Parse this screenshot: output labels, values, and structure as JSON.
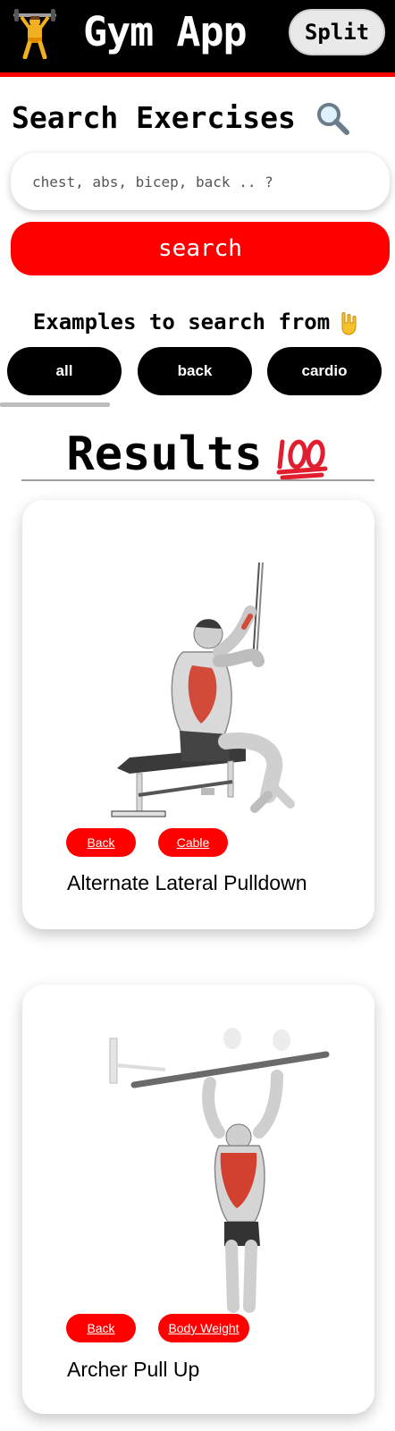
{
  "header": {
    "title": "Gym App",
    "split_label": "Split",
    "icon": "weightlifter-icon"
  },
  "search": {
    "heading": "Search Exercises",
    "heading_icon": "magnifier-icon",
    "placeholder": "chest, abs, bicep, back .. ?",
    "button_label": "search"
  },
  "examples": {
    "heading": "Examples to search from",
    "heading_icon": "pointing-down-icon",
    "chips": [
      "all",
      "back",
      "cardio"
    ]
  },
  "results": {
    "heading": "Results",
    "heading_icon": "hundred-points-icon",
    "items": [
      {
        "title": "Alternate Lateral Pulldown",
        "tags": [
          "Back",
          "Cable"
        ],
        "image": "lat-pulldown-illustration"
      },
      {
        "title": "Archer Pull Up",
        "tags": [
          "Back",
          "Body Weight"
        ],
        "image": "pull-up-illustration"
      }
    ]
  },
  "colors": {
    "accent": "#ff0000",
    "header_bg": "#000000",
    "chip_bg": "#000000"
  }
}
